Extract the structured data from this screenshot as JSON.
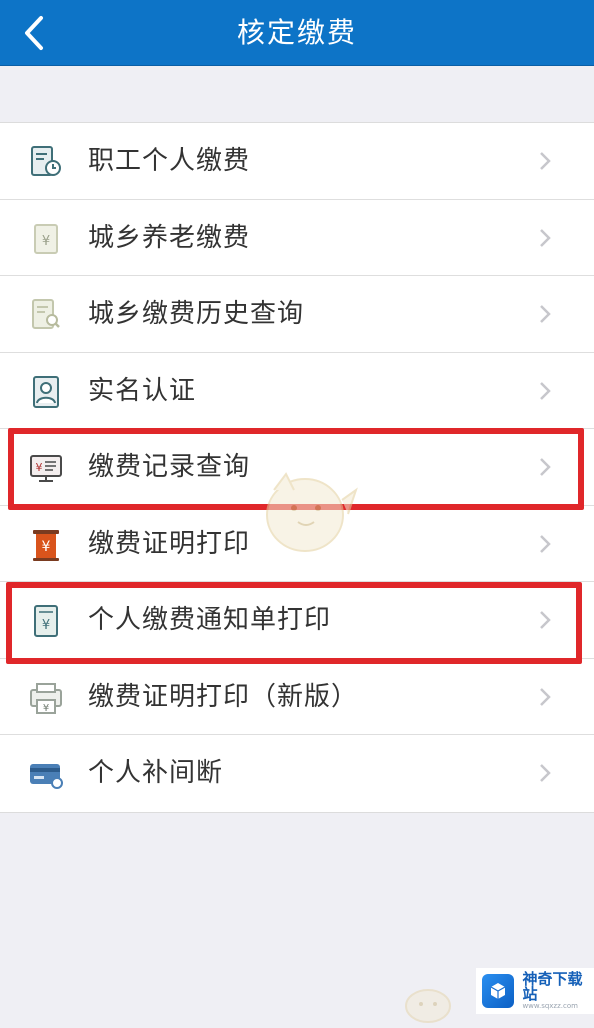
{
  "header": {
    "title": "核定缴费",
    "back_icon": "chevron-left-icon",
    "bg_color": "#0d74c7"
  },
  "menu": {
    "items": [
      {
        "id": "worker",
        "label": "职工个人缴费",
        "icon": "document-clock-icon",
        "highlighted": false
      },
      {
        "id": "pension",
        "label": "城乡养老缴费",
        "icon": "yuan-note-icon",
        "highlighted": false
      },
      {
        "id": "history",
        "label": "城乡缴费历史查询",
        "icon": "document-search-icon",
        "highlighted": false
      },
      {
        "id": "realname",
        "label": "实名认证",
        "icon": "id-photo-icon",
        "highlighted": false
      },
      {
        "id": "records",
        "label": "缴费记录查询",
        "icon": "monitor-yuan-icon",
        "highlighted": true
      },
      {
        "id": "certificate",
        "label": "缴费证明打印",
        "icon": "scroll-yuan-icon",
        "highlighted": false
      },
      {
        "id": "notice",
        "label": "个人缴费通知单打印",
        "icon": "notice-yuan-icon",
        "highlighted": true
      },
      {
        "id": "certificate_new",
        "label": "缴费证明打印（新版）",
        "icon": "printer-yuan-icon",
        "highlighted": false
      },
      {
        "id": "interruption",
        "label": "个人补间断",
        "icon": "card-icon",
        "highlighted": false
      }
    ]
  },
  "watermark": {
    "name": "神奇下载站",
    "url": "www.sqxzz.com",
    "logo_icon": "cube-icon"
  },
  "colors": {
    "highlight_border": "#e0272a",
    "icon_teal": "#3f6f78",
    "icon_orange": "#d9541c"
  }
}
